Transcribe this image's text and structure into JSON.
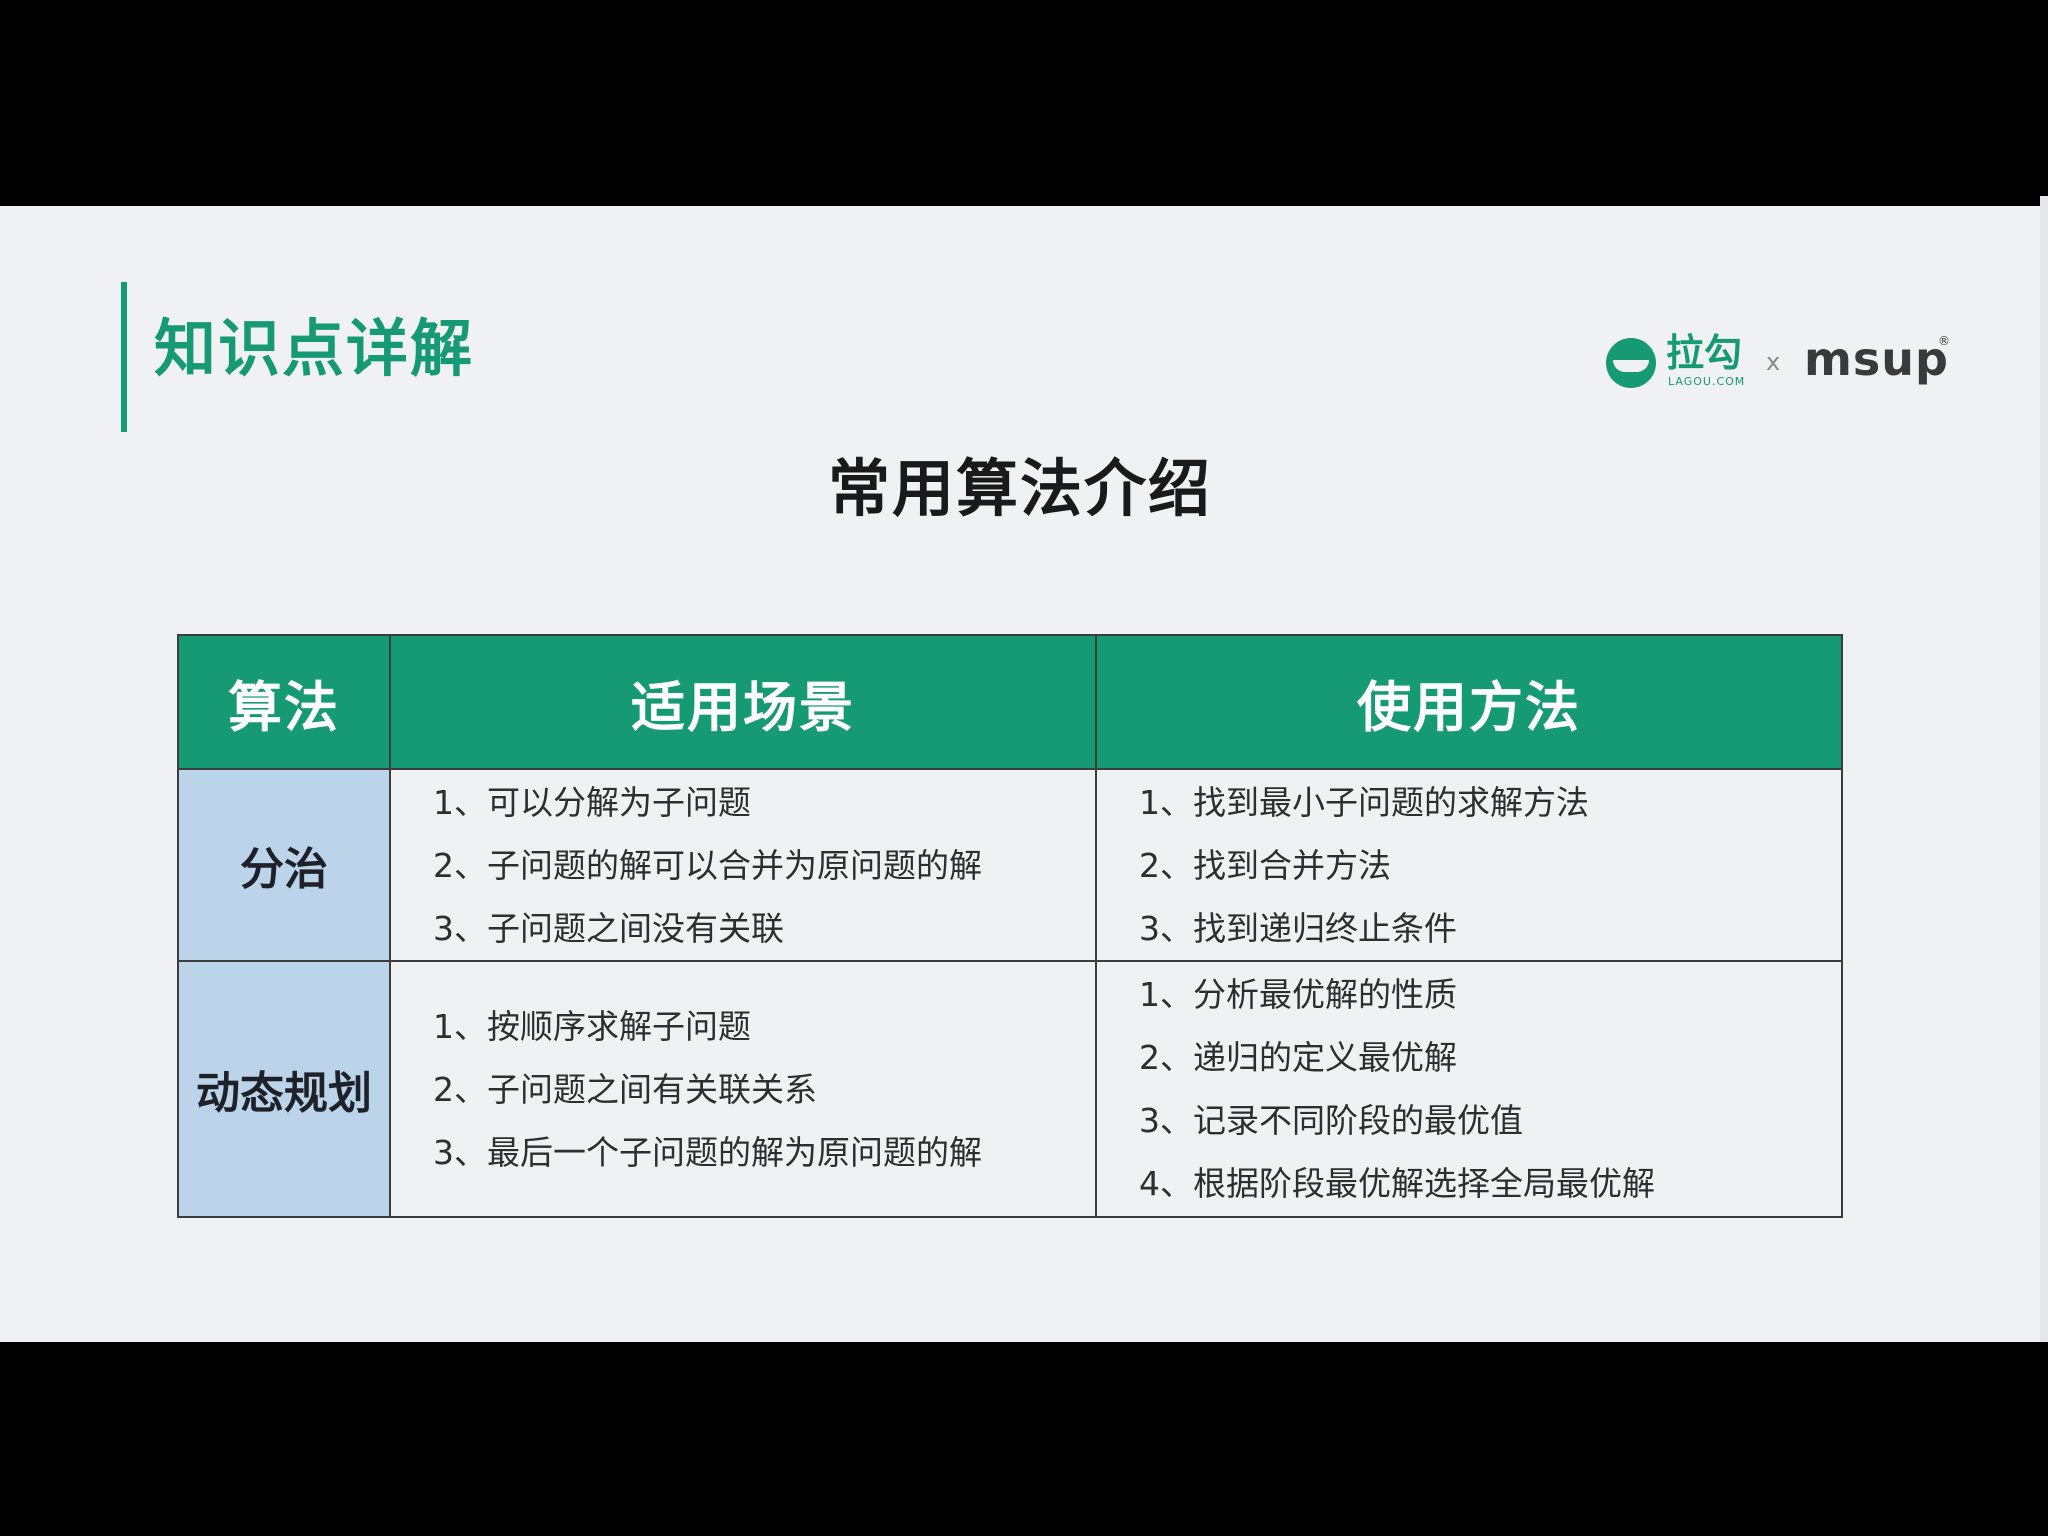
{
  "section_title": "知识点详解",
  "brand": {
    "lagou_name": "拉勾",
    "lagou_sub": "LAGOU.COM",
    "separator": "x",
    "partner": "msup",
    "partner_mark": "®"
  },
  "main_title": "常用算法介绍",
  "table": {
    "headers": [
      "算法",
      "适用场景",
      "使用方法"
    ],
    "rows": [
      {
        "algorithm": "分治",
        "scenarios": [
          "1、可以分解为子问题",
          "2、子问题的解可以合并为原问题的解",
          "3、子问题之间没有关联"
        ],
        "methods": [
          "1、找到最小子问题的求解方法",
          "2、找到合并方法",
          "3、找到递归终止条件"
        ]
      },
      {
        "algorithm": "动态规划",
        "scenarios": [
          "1、按顺序求解子问题",
          "2、子问题之间有关联关系",
          "3、最后一个子问题的解为原问题的解"
        ],
        "methods": [
          "1、分析最优解的性质",
          "2、递归的定义最优解",
          "3、记录不同阶段的最优值",
          "4、根据阶段最优解选择全局最优解"
        ]
      }
    ]
  },
  "colors": {
    "brand_green": "#159a73",
    "algo_cell_blue": "#bcd4ea",
    "slide_bg": "#f0f1f3"
  }
}
